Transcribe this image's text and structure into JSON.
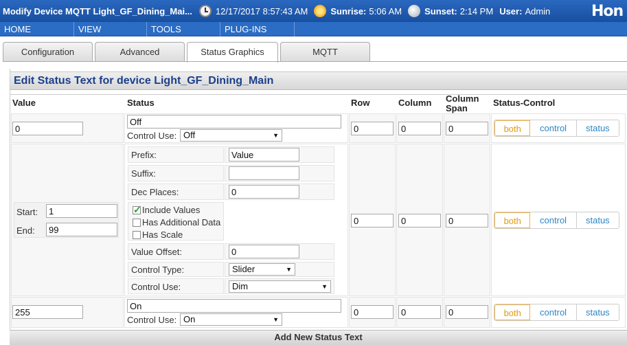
{
  "header": {
    "title": "Modify Device MQTT Light_GF_Dining_Mai...",
    "datetime": "12/17/2017 8:57:43 AM",
    "sunrise_label": "Sunrise:",
    "sunrise_time": "5:06 AM",
    "sunset_label": "Sunset:",
    "sunset_time": "2:14 PM",
    "user_label": "User:",
    "user_name": "Admin",
    "logo_text": "Hon"
  },
  "menu": [
    "HOME",
    "VIEW",
    "TOOLS",
    "PLUG-INS"
  ],
  "tabs": [
    "Configuration",
    "Advanced",
    "Status Graphics",
    "MQTT"
  ],
  "active_tab": "Status Graphics",
  "panel_title": "Edit Status Text for device Light_GF_Dining_Main",
  "columns": {
    "value": "Value",
    "status": "Status",
    "row": "Row",
    "column": "Column",
    "column_span_1": "Column",
    "column_span_2": "Span",
    "status_control": "Status-Control"
  },
  "control_use_label": "Control Use:",
  "segment_labels": [
    "both",
    "control",
    "status"
  ],
  "rows": [
    {
      "value": "0",
      "status": "Off",
      "control_use": "Off",
      "row": "0",
      "column": "0",
      "span": "0",
      "selected": "both"
    },
    {
      "start_label": "Start:",
      "start": "1",
      "end_label": "End:",
      "end": "99",
      "prefix_label": "Prefix:",
      "prefix": "Value",
      "suffix_label": "Suffix:",
      "suffix": "",
      "dec_label": "Dec Places:",
      "dec": "0",
      "include_values": "Include Values",
      "has_additional": "Has Additional Data",
      "has_scale": "Has Scale",
      "offset_label": "Value Offset:",
      "offset": "0",
      "control_type_label": "Control Type:",
      "control_type": "Slider",
      "control_use": "Dim",
      "row": "0",
      "column": "0",
      "span": "0",
      "selected": "both"
    },
    {
      "value": "255",
      "status": "On",
      "control_use": "On",
      "row": "0",
      "column": "0",
      "span": "0",
      "selected": "both"
    }
  ],
  "footer_text": "Add New Status Text",
  "colors": {
    "header_blue": "#1f5bb0",
    "title_blue": "#1b3f8a",
    "accent_orange": "#e19a12",
    "link_blue": "#2a86c6"
  }
}
